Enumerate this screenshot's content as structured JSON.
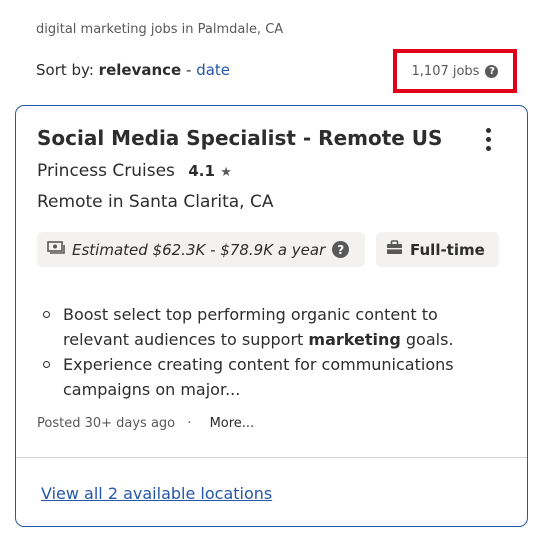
{
  "search_description": "digital marketing jobs in Palmdale, CA",
  "sort": {
    "prefix": "Sort by:",
    "active": "relevance",
    "separator": "-",
    "alternate": "date"
  },
  "job_count": "1,107 jobs",
  "job": {
    "title": "Social Media Specialist - Remote US",
    "company": "Princess Cruises",
    "rating": "4.1",
    "location": "Remote in Santa Clarita, CA",
    "salary": "Estimated $62.3K - $78.9K a year",
    "job_type": "Full-time",
    "snippet": [
      {
        "before": "Boost select top performing organic content to relevant audiences to support ",
        "bold": "marketing",
        "after": " goals."
      },
      {
        "before": "Experience creating content for communications campaigns on major...",
        "bold": "",
        "after": ""
      }
    ],
    "posted": "Posted 30+ days ago",
    "dot": "·",
    "more": "More...",
    "locations_link": "View all 2 available locations"
  }
}
